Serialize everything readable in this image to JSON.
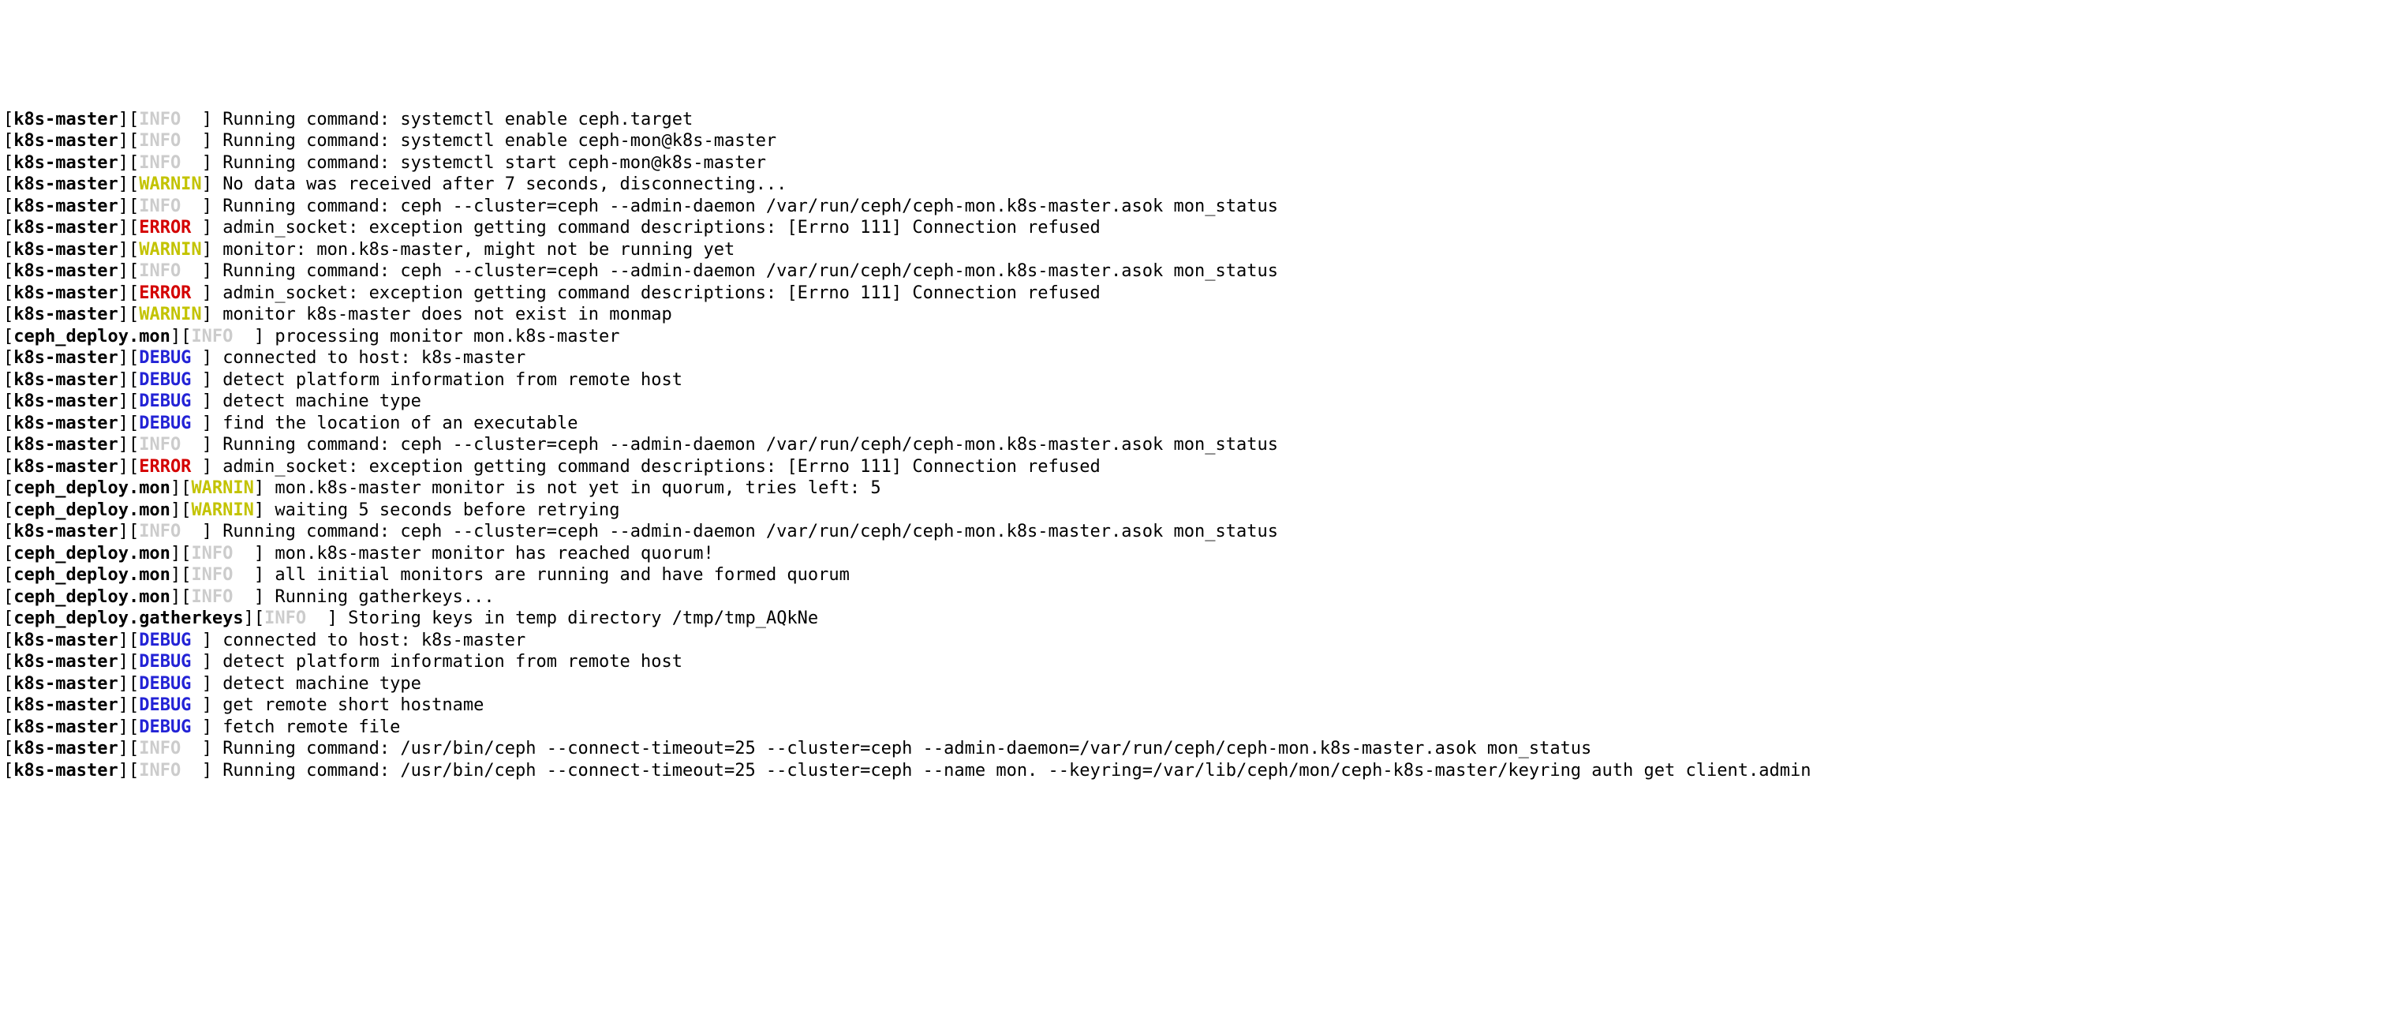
{
  "logs": [
    {
      "source": "k8s-master",
      "level": "INFO",
      "msg": "Running command: systemctl enable ceph.target"
    },
    {
      "source": "k8s-master",
      "level": "INFO",
      "msg": "Running command: systemctl enable ceph-mon@k8s-master"
    },
    {
      "source": "k8s-master",
      "level": "INFO",
      "msg": "Running command: systemctl start ceph-mon@k8s-master"
    },
    {
      "source": "k8s-master",
      "level": "WARNIN",
      "msg": "No data was received after 7 seconds, disconnecting..."
    },
    {
      "source": "k8s-master",
      "level": "INFO",
      "msg": "Running command: ceph --cluster=ceph --admin-daemon /var/run/ceph/ceph-mon.k8s-master.asok mon_status"
    },
    {
      "source": "k8s-master",
      "level": "ERROR",
      "msg": "admin_socket: exception getting command descriptions: [Errno 111] Connection refused"
    },
    {
      "source": "k8s-master",
      "level": "WARNIN",
      "msg": "monitor: mon.k8s-master, might not be running yet"
    },
    {
      "source": "k8s-master",
      "level": "INFO",
      "msg": "Running command: ceph --cluster=ceph --admin-daemon /var/run/ceph/ceph-mon.k8s-master.asok mon_status"
    },
    {
      "source": "k8s-master",
      "level": "ERROR",
      "msg": "admin_socket: exception getting command descriptions: [Errno 111] Connection refused"
    },
    {
      "source": "k8s-master",
      "level": "WARNIN",
      "msg": "monitor k8s-master does not exist in monmap"
    },
    {
      "source": "ceph_deploy.mon",
      "level": "INFO",
      "msg": "processing monitor mon.k8s-master"
    },
    {
      "source": "k8s-master",
      "level": "DEBUG",
      "msg": "connected to host: k8s-master "
    },
    {
      "source": "k8s-master",
      "level": "DEBUG",
      "msg": "detect platform information from remote host"
    },
    {
      "source": "k8s-master",
      "level": "DEBUG",
      "msg": "detect machine type"
    },
    {
      "source": "k8s-master",
      "level": "DEBUG",
      "msg": "find the location of an executable"
    },
    {
      "source": "k8s-master",
      "level": "INFO",
      "msg": "Running command: ceph --cluster=ceph --admin-daemon /var/run/ceph/ceph-mon.k8s-master.asok mon_status"
    },
    {
      "source": "k8s-master",
      "level": "ERROR",
      "msg": "admin_socket: exception getting command descriptions: [Errno 111] Connection refused"
    },
    {
      "source": "ceph_deploy.mon",
      "level": "WARNIN",
      "msg": "mon.k8s-master monitor is not yet in quorum, tries left: 5"
    },
    {
      "source": "ceph_deploy.mon",
      "level": "WARNIN",
      "msg": "waiting 5 seconds before retrying"
    },
    {
      "source": "k8s-master",
      "level": "INFO",
      "msg": "Running command: ceph --cluster=ceph --admin-daemon /var/run/ceph/ceph-mon.k8s-master.asok mon_status"
    },
    {
      "source": "ceph_deploy.mon",
      "level": "INFO",
      "msg": "mon.k8s-master monitor has reached quorum!"
    },
    {
      "source": "ceph_deploy.mon",
      "level": "INFO",
      "msg": "all initial monitors are running and have formed quorum"
    },
    {
      "source": "ceph_deploy.mon",
      "level": "INFO",
      "msg": "Running gatherkeys..."
    },
    {
      "source": "ceph_deploy.gatherkeys",
      "level": "INFO",
      "msg": "Storing keys in temp directory /tmp/tmp_AQkNe"
    },
    {
      "source": "k8s-master",
      "level": "DEBUG",
      "msg": "connected to host: k8s-master "
    },
    {
      "source": "k8s-master",
      "level": "DEBUG",
      "msg": "detect platform information from remote host"
    },
    {
      "source": "k8s-master",
      "level": "DEBUG",
      "msg": "detect machine type"
    },
    {
      "source": "k8s-master",
      "level": "DEBUG",
      "msg": "get remote short hostname"
    },
    {
      "source": "k8s-master",
      "level": "DEBUG",
      "msg": "fetch remote file"
    },
    {
      "source": "k8s-master",
      "level": "INFO",
      "msg": "Running command: /usr/bin/ceph --connect-timeout=25 --cluster=ceph --admin-daemon=/var/run/ceph/ceph-mon.k8s-master.asok mon_status"
    },
    {
      "source": "k8s-master",
      "level": "INFO",
      "msg": "Running command: /usr/bin/ceph --connect-timeout=25 --cluster=ceph --name mon. --keyring=/var/lib/ceph/mon/ceph-k8s-master/keyring auth get client.admin"
    }
  ],
  "level_class": {
    "INFO": "info",
    "DEBUG": "debug",
    "WARNIN": "warn",
    "ERROR": "error"
  },
  "level_pad": 6
}
